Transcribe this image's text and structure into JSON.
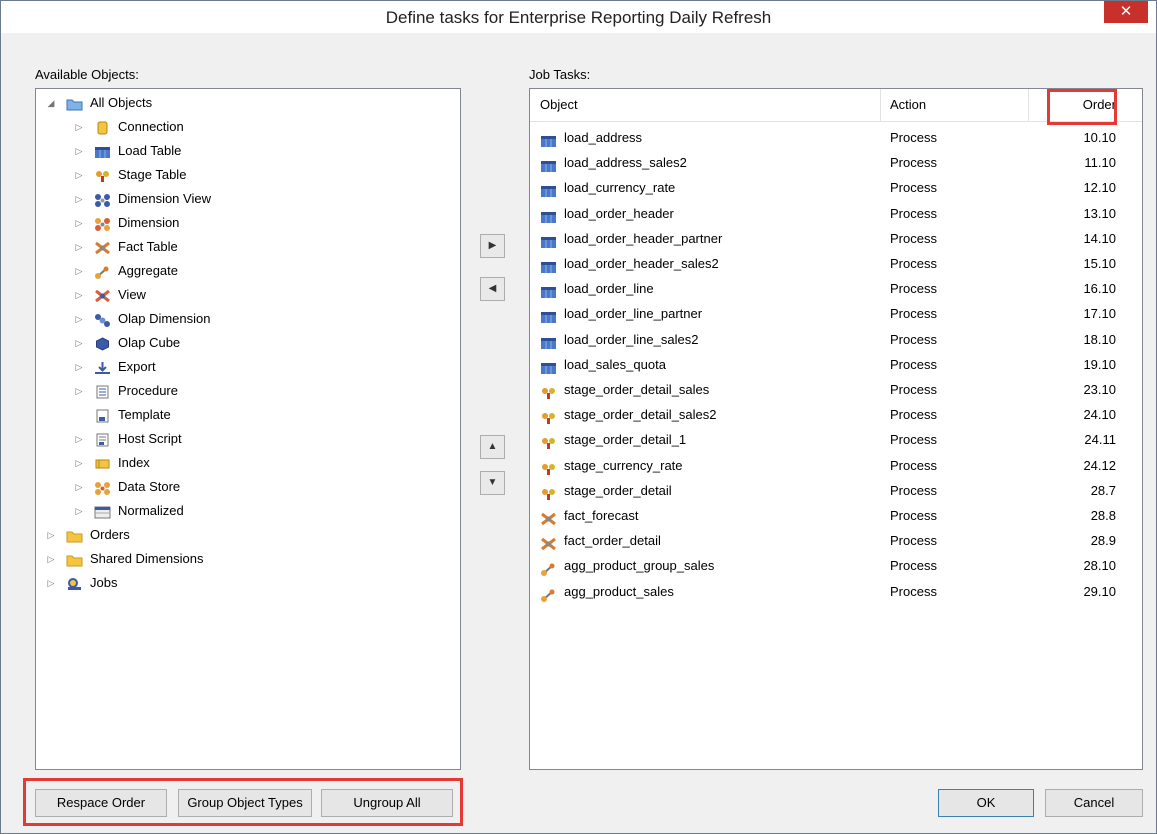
{
  "window": {
    "title": "Define tasks for Enterprise Reporting Daily Refresh",
    "close_label": "✕"
  },
  "available_objects": {
    "label": "Available Objects:",
    "tree": [
      {
        "label": "All Objects",
        "level": 0,
        "expander": "◢",
        "icon": "folder-blue-icon"
      },
      {
        "label": "Connection",
        "level": 1,
        "expander": "▷",
        "icon": "connection-icon"
      },
      {
        "label": "Load Table",
        "level": 1,
        "expander": "▷",
        "icon": "load-table-icon"
      },
      {
        "label": "Stage Table",
        "level": 1,
        "expander": "▷",
        "icon": "stage-table-icon"
      },
      {
        "label": "Dimension View",
        "level": 1,
        "expander": "▷",
        "icon": "dimension-view-icon"
      },
      {
        "label": "Dimension",
        "level": 1,
        "expander": "▷",
        "icon": "dimension-icon"
      },
      {
        "label": "Fact Table",
        "level": 1,
        "expander": "▷",
        "icon": "fact-table-icon"
      },
      {
        "label": "Aggregate",
        "level": 1,
        "expander": "▷",
        "icon": "aggregate-icon"
      },
      {
        "label": "View",
        "level": 1,
        "expander": "▷",
        "icon": "view-icon"
      },
      {
        "label": "Olap Dimension",
        "level": 1,
        "expander": "▷",
        "icon": "olap-dimension-icon"
      },
      {
        "label": "Olap Cube",
        "level": 1,
        "expander": "▷",
        "icon": "olap-cube-icon"
      },
      {
        "label": "Export",
        "level": 1,
        "expander": "▷",
        "icon": "export-icon"
      },
      {
        "label": "Procedure",
        "level": 1,
        "expander": "▷",
        "icon": "procedure-icon"
      },
      {
        "label": "Template",
        "level": 1,
        "expander": "",
        "icon": "template-icon"
      },
      {
        "label": "Host Script",
        "level": 1,
        "expander": "▷",
        "icon": "host-script-icon"
      },
      {
        "label": "Index",
        "level": 1,
        "expander": "▷",
        "icon": "index-icon"
      },
      {
        "label": "Data Store",
        "level": 1,
        "expander": "▷",
        "icon": "data-store-icon"
      },
      {
        "label": "Normalized",
        "level": 1,
        "expander": "▷",
        "icon": "normalized-icon"
      },
      {
        "label": "Orders",
        "level": 0,
        "expander": "▷",
        "icon": "folder-yellow-icon"
      },
      {
        "label": "Shared Dimensions",
        "level": 0,
        "expander": "▷",
        "icon": "folder-yellow-icon"
      },
      {
        "label": "Jobs",
        "level": 0,
        "expander": "▷",
        "icon": "jobs-icon"
      }
    ]
  },
  "job_tasks": {
    "label": "Job Tasks:",
    "columns": {
      "object": "Object",
      "action": "Action",
      "order": "Order"
    },
    "rows": [
      {
        "object": "load_address",
        "action": "Process",
        "order": "10.10",
        "icon": "load-table-icon"
      },
      {
        "object": "load_address_sales2",
        "action": "Process",
        "order": "11.10",
        "icon": "load-table-icon"
      },
      {
        "object": "load_currency_rate",
        "action": "Process",
        "order": "12.10",
        "icon": "load-table-icon"
      },
      {
        "object": "load_order_header",
        "action": "Process",
        "order": "13.10",
        "icon": "load-table-icon"
      },
      {
        "object": "load_order_header_partner",
        "action": "Process",
        "order": "14.10",
        "icon": "load-table-icon"
      },
      {
        "object": "load_order_header_sales2",
        "action": "Process",
        "order": "15.10",
        "icon": "load-table-icon"
      },
      {
        "object": "load_order_line",
        "action": "Process",
        "order": "16.10",
        "icon": "load-table-icon"
      },
      {
        "object": "load_order_line_partner",
        "action": "Process",
        "order": "17.10",
        "icon": "load-table-icon"
      },
      {
        "object": "load_order_line_sales2",
        "action": "Process",
        "order": "18.10",
        "icon": "load-table-icon"
      },
      {
        "object": "load_sales_quota",
        "action": "Process",
        "order": "19.10",
        "icon": "load-table-icon"
      },
      {
        "object": "stage_order_detail_sales",
        "action": "Process",
        "order": "23.10",
        "icon": "stage-table-icon"
      },
      {
        "object": "stage_order_detail_sales2",
        "action": "Process",
        "order": "24.10",
        "icon": "stage-table-icon"
      },
      {
        "object": "stage_order_detail_1",
        "action": "Process",
        "order": "24.11",
        "icon": "stage-table-icon"
      },
      {
        "object": "stage_currency_rate",
        "action": "Process",
        "order": "24.12",
        "icon": "stage-table-icon"
      },
      {
        "object": "stage_order_detail",
        "action": "Process",
        "order": "28.7",
        "icon": "stage-table-icon"
      },
      {
        "object": "fact_forecast",
        "action": "Process",
        "order": "28.8",
        "icon": "fact-table-icon"
      },
      {
        "object": "fact_order_detail",
        "action": "Process",
        "order": "28.9",
        "icon": "fact-table-icon"
      },
      {
        "object": "agg_product_group_sales",
        "action": "Process",
        "order": "28.10",
        "icon": "aggregate-icon"
      },
      {
        "object": "agg_product_sales",
        "action": "Process",
        "order": "29.10",
        "icon": "aggregate-icon"
      }
    ]
  },
  "transfer_buttons": {
    "add": "▶",
    "remove": "◀",
    "up": "▲",
    "down": "▼"
  },
  "footer": {
    "respace_order": "Respace Order",
    "group_object_types": "Group Object Types",
    "ungroup_all": "Ungroup All",
    "ok": "OK",
    "cancel": "Cancel"
  },
  "colors": {
    "highlight": "#e53935",
    "close_button": "#c7302b"
  }
}
